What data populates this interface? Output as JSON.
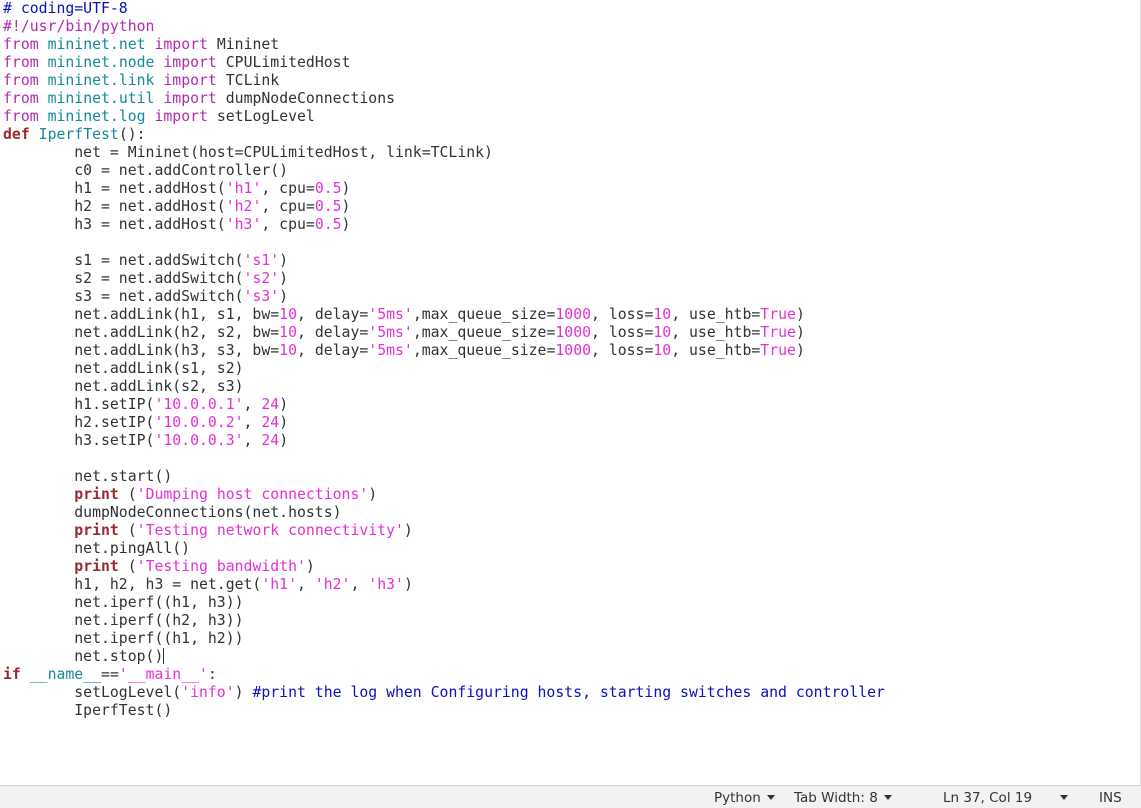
{
  "code_lines": [
    [
      [
        "comment",
        "# coding=UTF-8"
      ]
    ],
    [
      [
        "preproc",
        "#!/usr/bin/python"
      ]
    ],
    [
      [
        "preproc",
        "from"
      ],
      [
        "plain",
        " "
      ],
      [
        "module",
        "mininet.net"
      ],
      [
        "plain",
        " "
      ],
      [
        "preproc",
        "import"
      ],
      [
        "plain",
        " Mininet"
      ]
    ],
    [
      [
        "preproc",
        "from"
      ],
      [
        "plain",
        " "
      ],
      [
        "module",
        "mininet.node"
      ],
      [
        "plain",
        " "
      ],
      [
        "preproc",
        "import"
      ],
      [
        "plain",
        " CPULimitedHost"
      ]
    ],
    [
      [
        "preproc",
        "from"
      ],
      [
        "plain",
        " "
      ],
      [
        "module",
        "mininet.link"
      ],
      [
        "plain",
        " "
      ],
      [
        "preproc",
        "import"
      ],
      [
        "plain",
        " TCLink"
      ]
    ],
    [
      [
        "preproc",
        "from"
      ],
      [
        "plain",
        " "
      ],
      [
        "module",
        "mininet.util"
      ],
      [
        "plain",
        " "
      ],
      [
        "preproc",
        "import"
      ],
      [
        "plain",
        " dumpNodeConnections"
      ]
    ],
    [
      [
        "preproc",
        "from"
      ],
      [
        "plain",
        " "
      ],
      [
        "module",
        "mininet.log"
      ],
      [
        "plain",
        " "
      ],
      [
        "preproc",
        "import"
      ],
      [
        "plain",
        " setLogLevel"
      ]
    ],
    [
      [
        "keyword",
        "def"
      ],
      [
        "plain",
        " "
      ],
      [
        "func",
        "IperfTest"
      ],
      [
        "plain",
        "():"
      ]
    ],
    [
      [
        "plain",
        "        net = Mininet(host=CPULimitedHost, link=TCLink)"
      ]
    ],
    [
      [
        "plain",
        "        c0 = net.addController()"
      ]
    ],
    [
      [
        "plain",
        "        h1 = net.addHost("
      ],
      [
        "string",
        "'h1'"
      ],
      [
        "plain",
        ", cpu="
      ],
      [
        "number",
        "0.5"
      ],
      [
        "plain",
        ")"
      ]
    ],
    [
      [
        "plain",
        "        h2 = net.addHost("
      ],
      [
        "string",
        "'h2'"
      ],
      [
        "plain",
        ", cpu="
      ],
      [
        "number",
        "0.5"
      ],
      [
        "plain",
        ")"
      ]
    ],
    [
      [
        "plain",
        "        h3 = net.addHost("
      ],
      [
        "string",
        "'h3'"
      ],
      [
        "plain",
        ", cpu="
      ],
      [
        "number",
        "0.5"
      ],
      [
        "plain",
        ")"
      ]
    ],
    [
      [
        "plain",
        ""
      ]
    ],
    [
      [
        "plain",
        "        s1 = net.addSwitch("
      ],
      [
        "string",
        "'s1'"
      ],
      [
        "plain",
        ")"
      ]
    ],
    [
      [
        "plain",
        "        s2 = net.addSwitch("
      ],
      [
        "string",
        "'s2'"
      ],
      [
        "plain",
        ")"
      ]
    ],
    [
      [
        "plain",
        "        s3 = net.addSwitch("
      ],
      [
        "string",
        "'s3'"
      ],
      [
        "plain",
        ")"
      ]
    ],
    [
      [
        "plain",
        "        net.addLink(h1, s1, bw="
      ],
      [
        "number",
        "10"
      ],
      [
        "plain",
        ", delay="
      ],
      [
        "string",
        "'5ms'"
      ],
      [
        "plain",
        ",max_queue_size="
      ],
      [
        "number",
        "1000"
      ],
      [
        "plain",
        ", loss="
      ],
      [
        "number",
        "10"
      ],
      [
        "plain",
        ", use_htb="
      ],
      [
        "builtin",
        "True"
      ],
      [
        "plain",
        ")"
      ]
    ],
    [
      [
        "plain",
        "        net.addLink(h2, s2, bw="
      ],
      [
        "number",
        "10"
      ],
      [
        "plain",
        ", delay="
      ],
      [
        "string",
        "'5ms'"
      ],
      [
        "plain",
        ",max_queue_size="
      ],
      [
        "number",
        "1000"
      ],
      [
        "plain",
        ", loss="
      ],
      [
        "number",
        "10"
      ],
      [
        "plain",
        ", use_htb="
      ],
      [
        "builtin",
        "True"
      ],
      [
        "plain",
        ")"
      ]
    ],
    [
      [
        "plain",
        "        net.addLink(h3, s3, bw="
      ],
      [
        "number",
        "10"
      ],
      [
        "plain",
        ", delay="
      ],
      [
        "string",
        "'5ms'"
      ],
      [
        "plain",
        ",max_queue_size="
      ],
      [
        "number",
        "1000"
      ],
      [
        "plain",
        ", loss="
      ],
      [
        "number",
        "10"
      ],
      [
        "plain",
        ", use_htb="
      ],
      [
        "builtin",
        "True"
      ],
      [
        "plain",
        ")"
      ]
    ],
    [
      [
        "plain",
        "        net.addLink(s1, s2)"
      ]
    ],
    [
      [
        "plain",
        "        net.addLink(s2, s3)"
      ]
    ],
    [
      [
        "plain",
        "        h1.setIP("
      ],
      [
        "string",
        "'10.0.0.1'"
      ],
      [
        "plain",
        ", "
      ],
      [
        "number",
        "24"
      ],
      [
        "plain",
        ")"
      ]
    ],
    [
      [
        "plain",
        "        h2.setIP("
      ],
      [
        "string",
        "'10.0.0.2'"
      ],
      [
        "plain",
        ", "
      ],
      [
        "number",
        "24"
      ],
      [
        "plain",
        ")"
      ]
    ],
    [
      [
        "plain",
        "        h3.setIP("
      ],
      [
        "string",
        "'10.0.0.3'"
      ],
      [
        "plain",
        ", "
      ],
      [
        "number",
        "24"
      ],
      [
        "plain",
        ")"
      ]
    ],
    [
      [
        "plain",
        ""
      ]
    ],
    [
      [
        "plain",
        "        net.start()"
      ]
    ],
    [
      [
        "plain",
        "        "
      ],
      [
        "print",
        "print"
      ],
      [
        "plain",
        " ("
      ],
      [
        "string",
        "'Dumping host connections'"
      ],
      [
        "plain",
        ")"
      ]
    ],
    [
      [
        "plain",
        "        dumpNodeConnections(net.hosts)"
      ]
    ],
    [
      [
        "plain",
        "        "
      ],
      [
        "print",
        "print"
      ],
      [
        "plain",
        " ("
      ],
      [
        "string",
        "'Testing network connectivity'"
      ],
      [
        "plain",
        ")"
      ]
    ],
    [
      [
        "plain",
        "        net.pingAll()"
      ]
    ],
    [
      [
        "plain",
        "        "
      ],
      [
        "print",
        "print"
      ],
      [
        "plain",
        " ("
      ],
      [
        "string",
        "'Testing bandwidth'"
      ],
      [
        "plain",
        ")"
      ]
    ],
    [
      [
        "plain",
        "        h1, h2, h3 = net.get("
      ],
      [
        "string",
        "'h1'"
      ],
      [
        "plain",
        ", "
      ],
      [
        "string",
        "'h2'"
      ],
      [
        "plain",
        ", "
      ],
      [
        "string",
        "'h3'"
      ],
      [
        "plain",
        ")"
      ]
    ],
    [
      [
        "plain",
        "        net.iperf((h1, h3))"
      ]
    ],
    [
      [
        "plain",
        "        net.iperf((h2, h3))"
      ]
    ],
    [
      [
        "plain",
        "        net.iperf((h1, h2))"
      ]
    ],
    [
      [
        "plain",
        "        net.stop()"
      ],
      [
        "caret",
        ""
      ]
    ],
    [
      [
        "keyword",
        "if"
      ],
      [
        "plain",
        " "
      ],
      [
        "func",
        "__name__"
      ],
      [
        "plain",
        "=="
      ],
      [
        "string",
        "'__main__'"
      ],
      [
        "plain",
        ":"
      ]
    ],
    [
      [
        "plain",
        "        setLogLevel("
      ],
      [
        "string",
        "'info'"
      ],
      [
        "plain",
        ") "
      ],
      [
        "comment",
        "#print the log when Configuring hosts, starting switches and controller"
      ]
    ],
    [
      [
        "plain",
        "        IperfTest()"
      ]
    ]
  ],
  "statusbar": {
    "language": "Python",
    "tab_width": "Tab Width: 8",
    "position": "Ln 37, Col 19",
    "mode": "INS"
  }
}
